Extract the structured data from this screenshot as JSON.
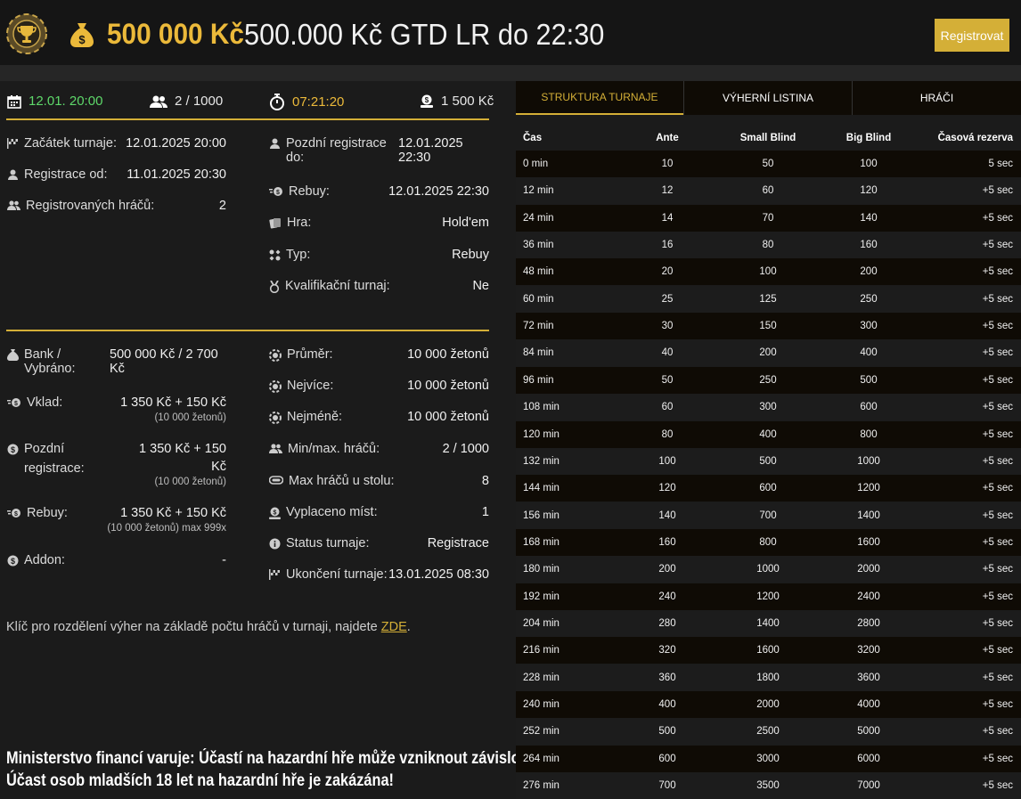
{
  "header": {
    "prize": "500 000 Kč",
    "title": "500.000 Kč GTD LR do 22:30",
    "register_label": "Registrovat"
  },
  "stats": {
    "date": "12.01. 20:00",
    "players": "2 / 1000",
    "timer": "07:21:20",
    "buyin": "1 500 Kč"
  },
  "info_left": [
    {
      "label": "Začátek turnaje:",
      "value": "12.01.2025 20:00"
    },
    {
      "label": "Registrace od:",
      "value": "11.01.2025 20:30"
    },
    {
      "label": "Registrovaných hráčů:",
      "value": "2"
    }
  ],
  "info_right": [
    {
      "label": "Pozdní registrace do:",
      "value": "12.01.2025 22:30"
    },
    {
      "label": "Rebuy:",
      "value": "12.01.2025 22:30"
    },
    {
      "label": "Hra:",
      "value": "Hold'em"
    },
    {
      "label": "Typ:",
      "value": "Rebuy"
    },
    {
      "label": "Kvalifikační turnaj:",
      "value": "Ne"
    }
  ],
  "money_left": [
    {
      "label": "Bank / Vybráno:",
      "value": "500 000 Kč / 2 700 Kč",
      "sub": ""
    },
    {
      "label": "Vklad:",
      "value": "1 350 Kč + 150 Kč",
      "sub": "(10 000 žetonů)"
    },
    {
      "label": "Pozdní registrace:",
      "value": "1 350 Kč + 150 Kč",
      "sub": "(10 000 žetonů)"
    },
    {
      "label": "Rebuy:",
      "value": "1 350 Kč + 150 Kč",
      "sub": "(10 000 žetonů) max 999x"
    },
    {
      "label": "Addon:",
      "value": "-",
      "sub": ""
    }
  ],
  "money_right": [
    {
      "label": "Průměr:",
      "value": "10 000 žetonů"
    },
    {
      "label": "Nejvíce:",
      "value": "10 000 žetonů"
    },
    {
      "label": "Nejméně:",
      "value": "10 000 žetonů"
    },
    {
      "label": "Min/max. hráčů:",
      "value": "2 / 1000"
    },
    {
      "label": "Max hráčů u stolu:",
      "value": "8"
    },
    {
      "label": "Vyplaceno míst:",
      "value": "1"
    },
    {
      "label": "Status turnaje:",
      "value": "Registrace"
    },
    {
      "label": "Ukončení turnaje:",
      "value": "13.01.2025 08:30"
    }
  ],
  "note": {
    "text": "Klíč pro rozdělení výher na základě počtu hráčů v turnaji, najdete ",
    "link": "ZDE",
    "end": "."
  },
  "warning": {
    "line1": "Ministerstvo financí varuje: Účastí na hazardní hře může vzniknout závislost!",
    "line2": "Účast osob mladších 18 let na hazardní hře je zakázána!"
  },
  "tabs": [
    "STRUKTURA TURNAJE",
    "VÝHERNÍ LISTINA",
    "HRÁČI"
  ],
  "table": {
    "headers": [
      "Čas",
      "Ante",
      "Small Blind",
      "Big Blind",
      "Časová rezerva"
    ],
    "rows": [
      [
        "0 min",
        "10",
        "50",
        "100",
        "5 sec"
      ],
      [
        "12 min",
        "12",
        "60",
        "120",
        "+5 sec"
      ],
      [
        "24 min",
        "14",
        "70",
        "140",
        "+5 sec"
      ],
      [
        "36 min",
        "16",
        "80",
        "160",
        "+5 sec"
      ],
      [
        "48 min",
        "20",
        "100",
        "200",
        "+5 sec"
      ],
      [
        "60 min",
        "25",
        "125",
        "250",
        "+5 sec"
      ],
      [
        "72 min",
        "30",
        "150",
        "300",
        "+5 sec"
      ],
      [
        "84 min",
        "40",
        "200",
        "400",
        "+5 sec"
      ],
      [
        "96 min",
        "50",
        "250",
        "500",
        "+5 sec"
      ],
      [
        "108 min",
        "60",
        "300",
        "600",
        "+5 sec"
      ],
      [
        "120 min",
        "80",
        "400",
        "800",
        "+5 sec"
      ],
      [
        "132 min",
        "100",
        "500",
        "1000",
        "+5 sec"
      ],
      [
        "144 min",
        "120",
        "600",
        "1200",
        "+5 sec"
      ],
      [
        "156 min",
        "140",
        "700",
        "1400",
        "+5 sec"
      ],
      [
        "168 min",
        "160",
        "800",
        "1600",
        "+5 sec"
      ],
      [
        "180 min",
        "200",
        "1000",
        "2000",
        "+5 sec"
      ],
      [
        "192 min",
        "240",
        "1200",
        "2400",
        "+5 sec"
      ],
      [
        "204 min",
        "280",
        "1400",
        "2800",
        "+5 sec"
      ],
      [
        "216 min",
        "320",
        "1600",
        "3200",
        "+5 sec"
      ],
      [
        "228 min",
        "360",
        "1800",
        "3600",
        "+5 sec"
      ],
      [
        "240 min",
        "400",
        "2000",
        "4000",
        "+5 sec"
      ],
      [
        "252 min",
        "500",
        "2500",
        "5000",
        "+5 sec"
      ],
      [
        "264 min",
        "600",
        "3000",
        "6000",
        "+5 sec"
      ],
      [
        "276 min",
        "700",
        "3500",
        "7000",
        "+5 sec"
      ]
    ]
  },
  "colors": {
    "accent": "#d4af37",
    "prize": "#ebb93a",
    "date_green": "#5ed86a",
    "bg": "#1b1b1b",
    "row_dark": "#0f0b05"
  }
}
